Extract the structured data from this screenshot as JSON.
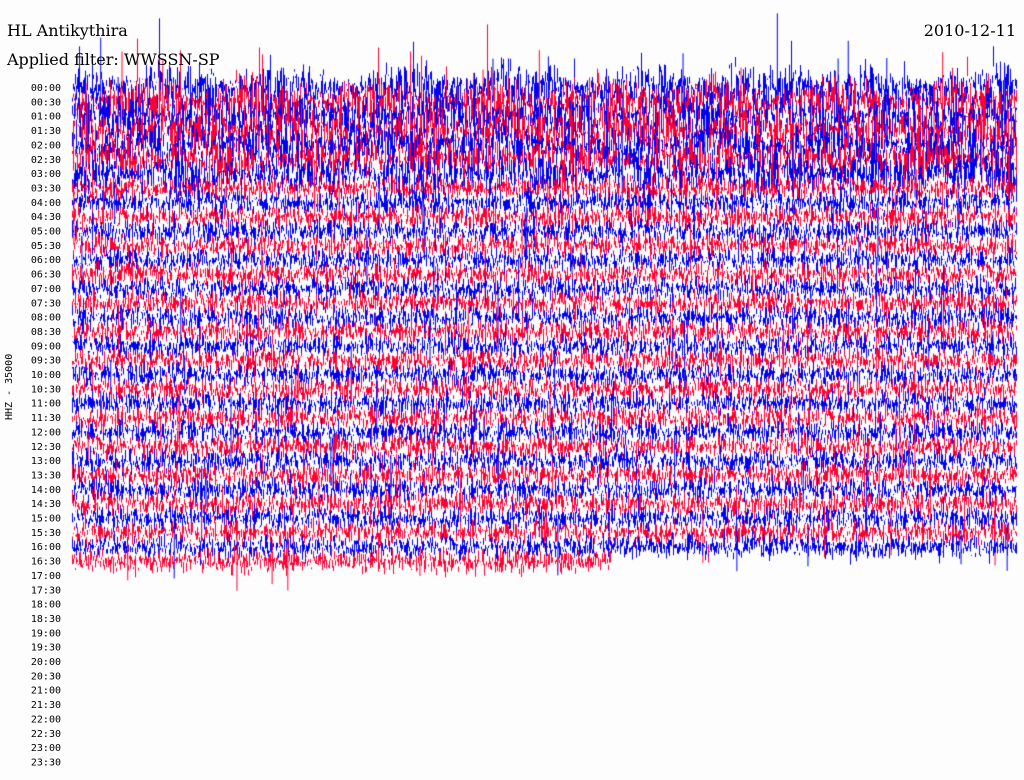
{
  "header": {
    "station": "HL Antikythira",
    "filter": "Applied filter: WWSSN-SP",
    "date": "2010-12-11",
    "channel": "HHZ - 35000"
  },
  "chart_data": {
    "type": "line",
    "title": "HL Antikythira",
    "subtitle": "Applied filter: WWSSN-SP",
    "date": "2010-12-11",
    "ylabel": "HHZ - 35000",
    "row_labels": [
      "00:00",
      "00:30",
      "01:00",
      "01:30",
      "02:00",
      "02:30",
      "03:00",
      "03:30",
      "04:00",
      "04:30",
      "05:00",
      "05:30",
      "06:00",
      "06:30",
      "07:00",
      "07:30",
      "08:00",
      "08:30",
      "09:00",
      "09:30",
      "10:00",
      "10:30",
      "11:00",
      "11:30",
      "12:00",
      "12:30",
      "13:00",
      "13:30",
      "14:00",
      "14:30",
      "15:00",
      "15:30",
      "16:00",
      "16:30",
      "17:00",
      "17:30",
      "18:00",
      "18:30",
      "19:00",
      "19:30",
      "20:00",
      "20:30",
      "21:00",
      "21:30",
      "22:00",
      "22:30",
      "23:00",
      "23:30"
    ],
    "series_colors": [
      "#0000ee",
      "#ff0033"
    ],
    "minutes_per_row": 30,
    "data_end_last_row_fraction": 0.57,
    "grid": false
  }
}
